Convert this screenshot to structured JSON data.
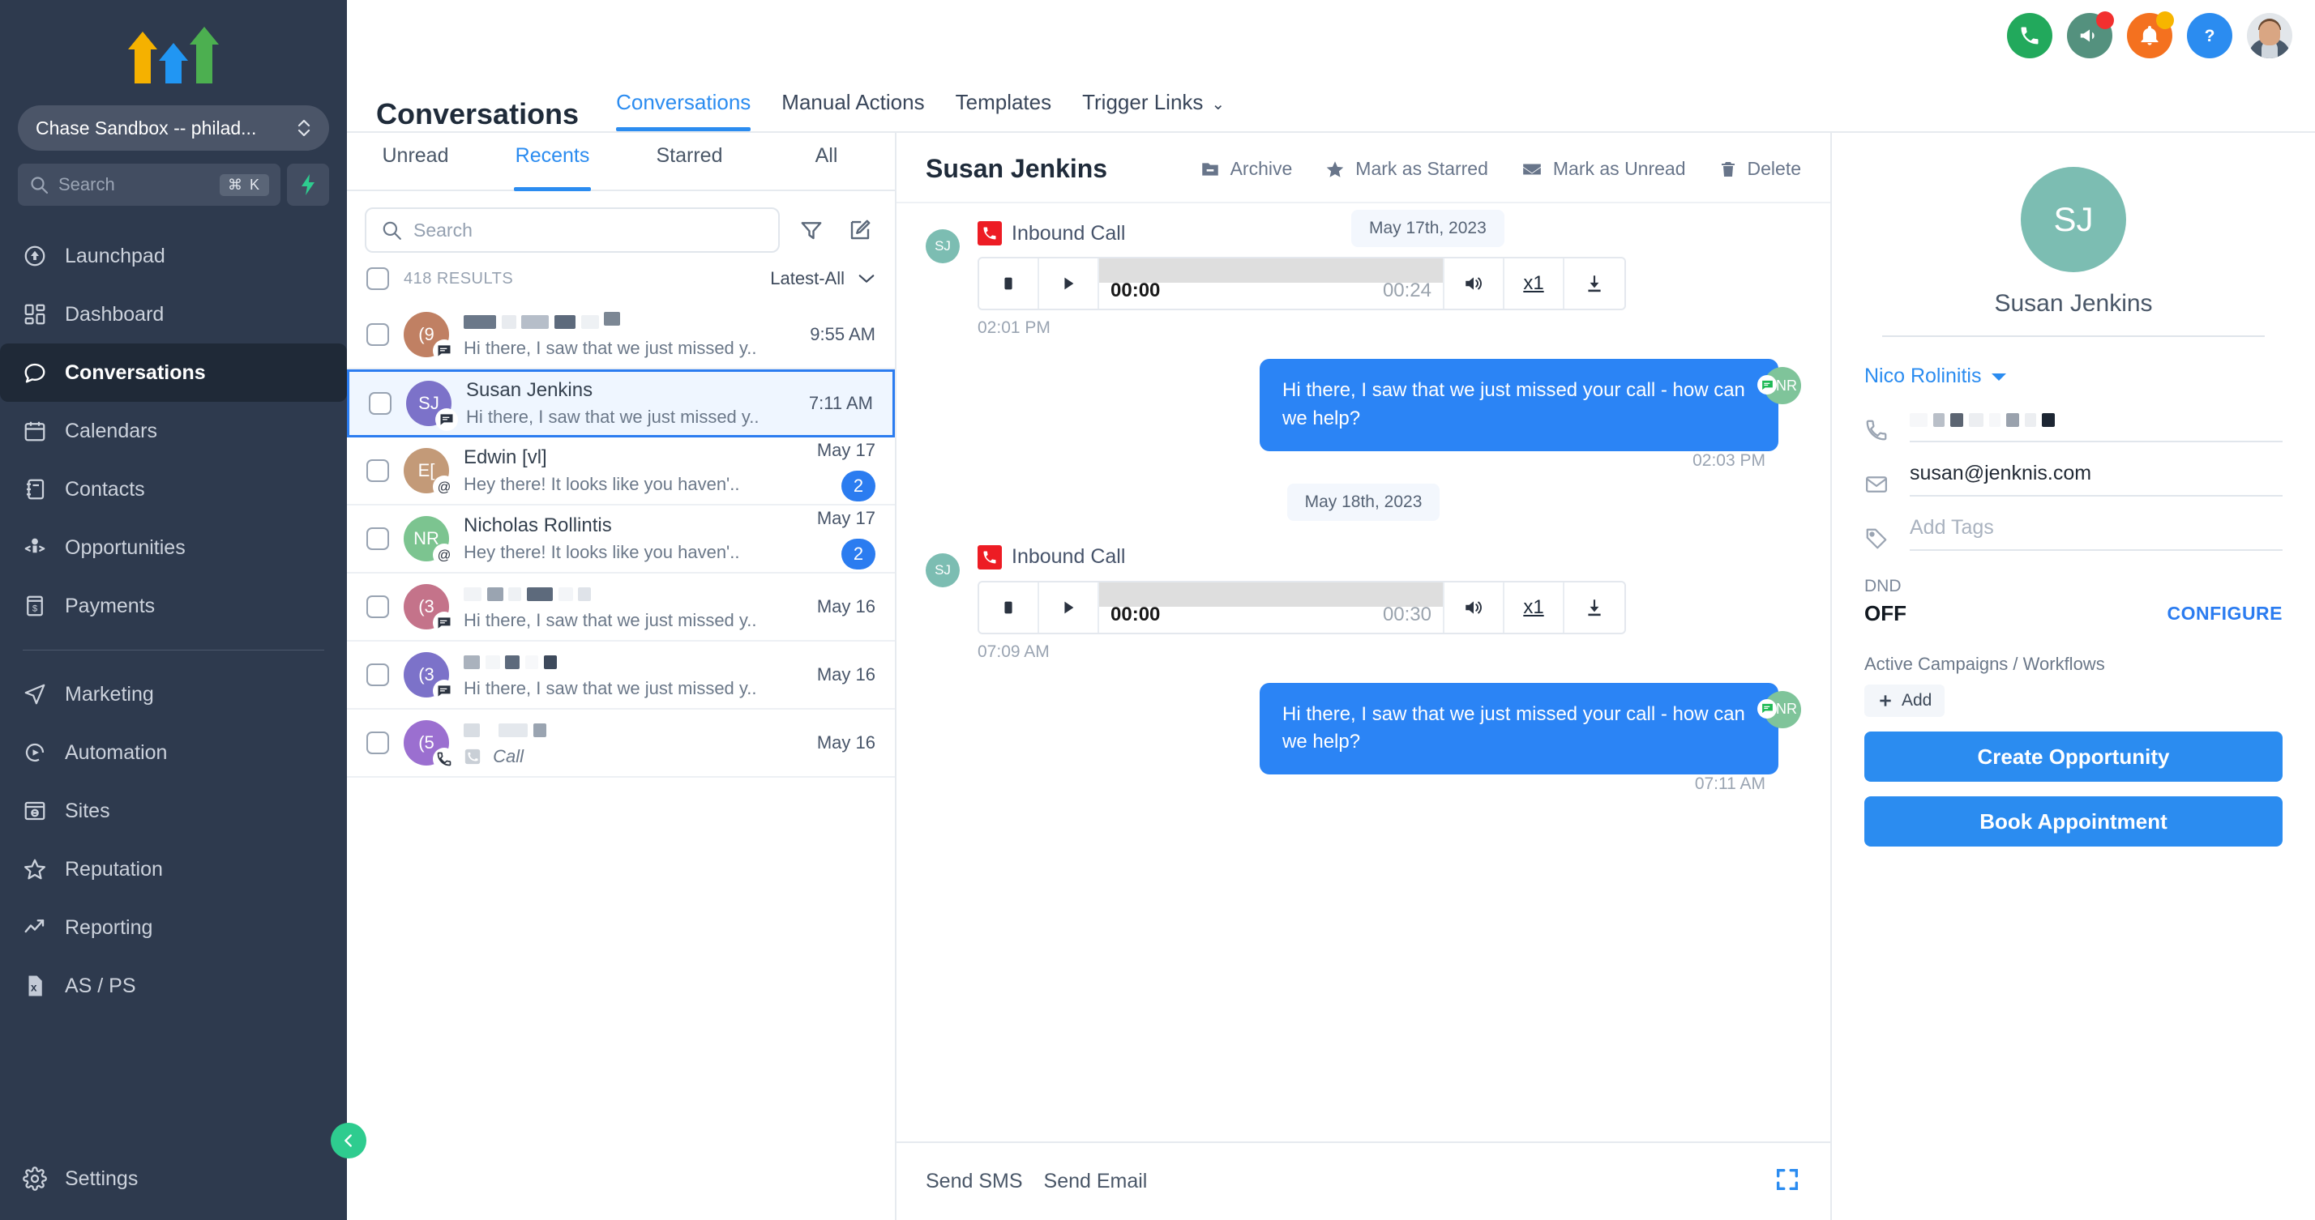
{
  "sidebar": {
    "workspace": "Chase Sandbox -- philad...",
    "search_placeholder": "Search",
    "search_kbd": "⌘ K",
    "items": [
      {
        "label": "Launchpad",
        "icon": "launchpad-icon",
        "active": false
      },
      {
        "label": "Dashboard",
        "icon": "dashboard-icon",
        "active": false
      },
      {
        "label": "Conversations",
        "icon": "chat-bubble-icon",
        "active": true
      },
      {
        "label": "Calendars",
        "icon": "calendar-icon",
        "active": false
      },
      {
        "label": "Contacts",
        "icon": "contacts-book-icon",
        "active": false
      },
      {
        "label": "Opportunities",
        "icon": "opportunities-icon",
        "active": false
      },
      {
        "label": "Payments",
        "icon": "payments-icon",
        "active": false
      }
    ],
    "items2": [
      {
        "label": "Marketing",
        "icon": "paper-plane-icon",
        "active": false
      },
      {
        "label": "Automation",
        "icon": "automation-play-icon",
        "active": false
      },
      {
        "label": "Sites",
        "icon": "sites-globe-icon",
        "active": false
      },
      {
        "label": "Reputation",
        "icon": "star-outline-icon",
        "active": false
      },
      {
        "label": "Reporting",
        "icon": "trend-up-icon",
        "active": false
      },
      {
        "label": "AS / PS",
        "icon": "excel-file-icon",
        "active": false
      }
    ],
    "settings": {
      "label": "Settings",
      "icon": "gear-icon"
    },
    "colors": {
      "bg": "#2e3a4e",
      "active_bg": "#1f2937",
      "accent_green": "#2ecc8f"
    }
  },
  "topbar": {
    "icons": [
      {
        "name": "phone-icon",
        "color": "#22a95c",
        "badge": null
      },
      {
        "name": "megaphone-icon",
        "color": "#54917e",
        "badge": "#f2302f"
      },
      {
        "name": "bell-icon",
        "color": "#f4711f",
        "badge": "#f7b500"
      },
      {
        "name": "help-question-icon",
        "color": "#2b8cf0",
        "badge": null
      }
    ],
    "avatar": "user-avatar"
  },
  "header": {
    "title": "Conversations",
    "tabs": [
      {
        "label": "Conversations",
        "active": true,
        "chevron": false
      },
      {
        "label": "Manual Actions",
        "active": false,
        "chevron": false
      },
      {
        "label": "Templates",
        "active": false,
        "chevron": false
      },
      {
        "label": "Trigger Links",
        "active": false,
        "chevron": true
      }
    ],
    "chevron_glyph": "⌄"
  },
  "list": {
    "tabs": [
      {
        "label": "Unread",
        "active": false
      },
      {
        "label": "Recents",
        "active": true
      },
      {
        "label": "Starred",
        "active": false
      },
      {
        "label": "All",
        "active": false
      }
    ],
    "search_placeholder": "Search",
    "filter_icon": "filter-funnel-icon",
    "compose_icon": "compose-pencil-icon",
    "results_label": "418 RESULTS",
    "sort_value": "Latest-All",
    "items": [
      {
        "name": "",
        "redacted": true,
        "initials": "(9",
        "avatar_color": "#c08063",
        "preview": "Hi there, I saw that we just missed y..",
        "time": "9:55 AM",
        "badge": null,
        "channel": "sms",
        "selected": false
      },
      {
        "name": "Susan Jenkins",
        "redacted": false,
        "initials": "SJ",
        "avatar_color": "#7c72c9",
        "preview": "Hi there, I saw that we just missed y..",
        "time": "7:11 AM",
        "badge": null,
        "channel": "sms",
        "selected": true
      },
      {
        "name": "Edwin [vl]",
        "redacted": false,
        "initials": "E[",
        "avatar_color": "#c39a78",
        "preview": "Hey there!  It looks like you haven'..",
        "time": "May 17",
        "badge": "2",
        "channel": "email",
        "selected": false
      },
      {
        "name": "Nicholas Rollintis",
        "redacted": false,
        "initials": "NR",
        "avatar_color": "#7cc490",
        "preview": "Hey there!  It looks like you haven'..",
        "time": "May 17",
        "badge": "2",
        "channel": "email",
        "selected": false
      },
      {
        "name": "",
        "redacted": true,
        "initials": "(3",
        "avatar_color": "#c4738a",
        "preview": "Hi there, I saw that we just missed y..",
        "time": "May 16",
        "badge": null,
        "channel": "sms",
        "selected": false
      },
      {
        "name": "",
        "redacted": true,
        "initials": "(3",
        "avatar_color": "#7c72c9",
        "preview": "Hi there, I saw that we just missed y..",
        "time": "May 16",
        "badge": null,
        "channel": "sms",
        "selected": false
      },
      {
        "name": "",
        "redacted": true,
        "initials": "(5",
        "avatar_color": "#9b6fd0",
        "preview": "Call",
        "time": "May 16",
        "badge": null,
        "channel": "call",
        "selected": false
      }
    ]
  },
  "thread": {
    "title": "Susan Jenkins",
    "actions": [
      {
        "label": "Archive",
        "icon": "archive-icon"
      },
      {
        "label": "Mark as Starred",
        "icon": "star-filled-icon"
      },
      {
        "label": "Mark as Unread",
        "icon": "envelope-icon"
      },
      {
        "label": "Delete",
        "icon": "trash-icon"
      }
    ],
    "messages": [
      {
        "kind": "call",
        "avatar_initials": "SJ",
        "label": "Inbound Call",
        "current_time": "00:00",
        "duration": "00:24",
        "speed": "x1",
        "timestamp": "02:01 PM",
        "date_chip": "May 17th, 2023"
      },
      {
        "kind": "outgoing",
        "text": "Hi there, I saw that we just missed your call - how can we help?",
        "avatar_initials": "NR",
        "timestamp": "02:03 PM"
      },
      {
        "kind": "date",
        "date_chip": "May 18th, 2023"
      },
      {
        "kind": "call",
        "avatar_initials": "SJ",
        "label": "Inbound Call",
        "current_time": "00:00",
        "duration": "00:30",
        "speed": "x1",
        "timestamp": "07:09 AM"
      },
      {
        "kind": "outgoing",
        "text": "Hi there, I saw that we just missed your call - how can we help?",
        "avatar_initials": "NR",
        "timestamp": "07:11 AM"
      }
    ],
    "composer": {
      "tabs": [
        {
          "label": "Send SMS",
          "active": true
        },
        {
          "label": "Send Email",
          "active": false
        }
      ],
      "expand_icon": "expand-fullscreen-icon"
    }
  },
  "contact": {
    "avatar_initials": "SJ",
    "avatar_color": "#7cbdb2",
    "name": "Susan Jenkins",
    "owner": "Nico Rolinitis",
    "phone_redacted": true,
    "phone": "",
    "email": "susan@jenknis.com",
    "tags_placeholder": "Add Tags",
    "dnd_label": "DND",
    "dnd_value": "OFF",
    "configure_label": "CONFIGURE",
    "campaigns_label": "Active Campaigns / Workflows",
    "add_label": "Add",
    "create_opportunity_label": "Create Opportunity",
    "book_appointment_label": "Book Appointment",
    "accent": "#2b8cf0"
  }
}
